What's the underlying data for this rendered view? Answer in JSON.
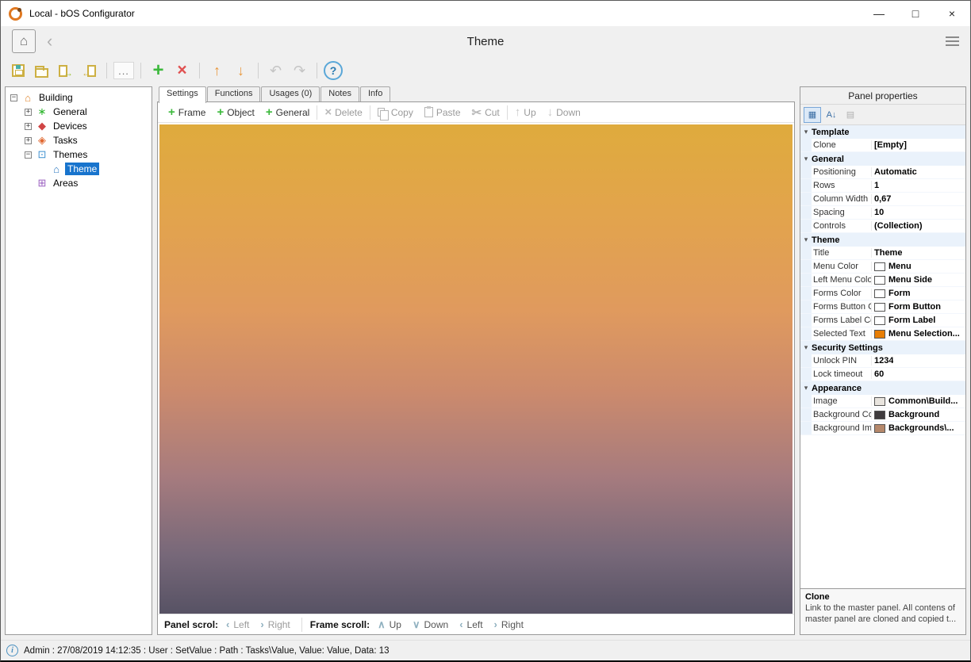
{
  "window": {
    "title": "Local - bOS Configurator",
    "controls": {
      "minimize": "—",
      "maximize": "□",
      "close": "×"
    }
  },
  "header": {
    "home_glyph": "⌂",
    "back_glyph": "‹",
    "title": "Theme"
  },
  "main_toolbar": [
    {
      "name": "save",
      "kind": "css",
      "icon": "save"
    },
    {
      "name": "open",
      "kind": "css",
      "icon": "folder"
    },
    {
      "name": "export",
      "kind": "css",
      "icon": "page-out"
    },
    {
      "name": "import",
      "kind": "css",
      "icon": "page-in"
    },
    {
      "name": "sep"
    },
    {
      "name": "more",
      "kind": "glyph",
      "glyph": "...",
      "color": "#707070"
    },
    {
      "name": "sep"
    },
    {
      "name": "add",
      "kind": "glyph",
      "glyph": "+",
      "color": "#3cb93c"
    },
    {
      "name": "delete",
      "kind": "glyph",
      "glyph": "×",
      "color": "#e05050"
    },
    {
      "name": "sep"
    },
    {
      "name": "move-up",
      "kind": "glyph",
      "glyph": "↑",
      "color": "#e8973c"
    },
    {
      "name": "move-down",
      "kind": "glyph",
      "glyph": "↓",
      "color": "#e8973c"
    },
    {
      "name": "sep"
    },
    {
      "name": "undo",
      "kind": "glyph",
      "glyph": "↶",
      "color": "#c4c4c4"
    },
    {
      "name": "redo",
      "kind": "glyph",
      "glyph": "↷",
      "color": "#c4c4c4"
    },
    {
      "name": "sep"
    },
    {
      "name": "help",
      "kind": "glyph",
      "glyph": "?",
      "color": "#2a7ab0",
      "circled": true
    }
  ],
  "tree": {
    "items": [
      {
        "label": "Building",
        "depth": 0,
        "expander": "open",
        "icon": "building",
        "selected": false
      },
      {
        "label": "General",
        "depth": 1,
        "expander": "closed",
        "icon": "general",
        "selected": false
      },
      {
        "label": "Devices",
        "depth": 1,
        "expander": "closed",
        "icon": "devices",
        "selected": false
      },
      {
        "label": "Tasks",
        "depth": 1,
        "expander": "closed",
        "icon": "tasks",
        "selected": false
      },
      {
        "label": "Themes",
        "depth": 1,
        "expander": "open",
        "icon": "themes",
        "selected": false
      },
      {
        "label": "Theme",
        "depth": 2,
        "expander": "none",
        "icon": "theme",
        "selected": true
      },
      {
        "label": "Areas",
        "depth": 1,
        "expander": "none",
        "icon": "areas",
        "selected": false
      }
    ],
    "icon_glyphs": {
      "building": "⌂",
      "general": "∗",
      "devices": "◆",
      "tasks": "◈",
      "themes": "⊡",
      "theme": "⌂",
      "areas": "⊞"
    },
    "icon_colors": {
      "building": "#e0862e",
      "general": "#2db52d",
      "devices": "#d04545",
      "tasks": "#e0662e",
      "themes": "#3c8fd0",
      "theme": "#2e7ac0",
      "areas": "#9a5fc0"
    }
  },
  "tabs": [
    {
      "label": "Settings",
      "active": true
    },
    {
      "label": "Functions",
      "active": false
    },
    {
      "label": "Usages (0)",
      "active": false
    },
    {
      "label": "Notes",
      "active": false
    },
    {
      "label": "Info",
      "active": false
    }
  ],
  "editor_toolbar": [
    {
      "label": "Frame",
      "icon": "plus",
      "enabled": true,
      "sep_after": false
    },
    {
      "label": "Object",
      "icon": "plus",
      "enabled": true,
      "sep_after": false
    },
    {
      "label": "General",
      "icon": "plus",
      "enabled": true,
      "sep_after": true
    },
    {
      "label": "Delete",
      "icon": "cross",
      "enabled": false,
      "sep_after": true
    },
    {
      "label": "Copy",
      "icon": "copy",
      "enabled": false,
      "sep_after": false
    },
    {
      "label": "Paste",
      "icon": "paste",
      "enabled": false,
      "sep_after": false
    },
    {
      "label": "Cut",
      "icon": "cut",
      "enabled": false,
      "sep_after": true
    },
    {
      "label": "Up",
      "icon": "up",
      "enabled": false,
      "sep_after": false
    },
    {
      "label": "Down",
      "icon": "down",
      "enabled": false,
      "sep_after": false
    }
  ],
  "canvas": {
    "gradient_stops": [
      "#dfab3d 0%",
      "#e2a44c 18%",
      "#e09a5e 38%",
      "#cb8a6d 55%",
      "#a67b7e 72%",
      "#776879 88%",
      "#575264 100%"
    ]
  },
  "panel_scroll": {
    "panel_label": "Panel scrol:",
    "panel_left": "Left",
    "panel_right": "Right",
    "frame_label": "Frame scroll:",
    "frame_up": "Up",
    "frame_down": "Down",
    "frame_left": "Left",
    "frame_right": "Right",
    "glyphs": {
      "left": "‹",
      "right": "›",
      "up": "∧",
      "down": "∨"
    }
  },
  "properties": {
    "title": "Panel properties",
    "toolbar": {
      "categorized": "▦",
      "alphabetical": "A↓",
      "pages": "▤"
    },
    "groups": [
      {
        "name": "Template",
        "rows": [
          {
            "label": "Clone",
            "value": "[Empty]",
            "swatch": null
          }
        ]
      },
      {
        "name": "General",
        "rows": [
          {
            "label": "Positioning",
            "value": "Automatic",
            "swatch": null
          },
          {
            "label": "Rows",
            "value": "1",
            "swatch": null
          },
          {
            "label": "Column Width",
            "value": "0,67",
            "swatch": null
          },
          {
            "label": "Spacing",
            "value": "10",
            "swatch": null
          },
          {
            "label": "Controls",
            "value": "(Collection)",
            "swatch": null
          }
        ]
      },
      {
        "name": "Theme",
        "rows": [
          {
            "label": "Title",
            "value": "Theme",
            "swatch": null
          },
          {
            "label": "Menu Color",
            "value": "Menu",
            "swatch": "#ffffff"
          },
          {
            "label": "Left Menu Color",
            "value": "Menu Side",
            "swatch": "#ffffff"
          },
          {
            "label": "Forms Color",
            "value": "Form",
            "swatch": "#ffffff"
          },
          {
            "label": "Forms Button Color",
            "value": "Form Button",
            "swatch": "#ffffff"
          },
          {
            "label": "Forms Label Color",
            "value": "Form Label",
            "swatch": "#ffffff"
          },
          {
            "label": "Selected Text",
            "value": "Menu Selection...",
            "swatch": "#e87e04"
          }
        ]
      },
      {
        "name": "Security Settings",
        "rows": [
          {
            "label": "Unlock PIN",
            "value": "1234",
            "swatch": null
          },
          {
            "label": "Lock timeout",
            "value": "60",
            "swatch": null
          }
        ]
      },
      {
        "name": "Appearance",
        "rows": [
          {
            "label": "Image",
            "value": "Common\\Build...",
            "swatch": "#e8e4de"
          },
          {
            "label": "Background Color",
            "value": "Background",
            "swatch": "#3f3b3d"
          },
          {
            "label": "Background Imag",
            "value": "Backgrounds\\...",
            "swatch": "#b5886b"
          }
        ]
      }
    ],
    "description_title": "Clone",
    "description_text": "Link to the master panel. All contens of master panel are cloned and copied t..."
  },
  "status_bar": {
    "text": "Admin : 27/08/2019 14:12:35 : User : SetValue : Path : Tasks\\Value, Value: Value, Data: 13"
  }
}
